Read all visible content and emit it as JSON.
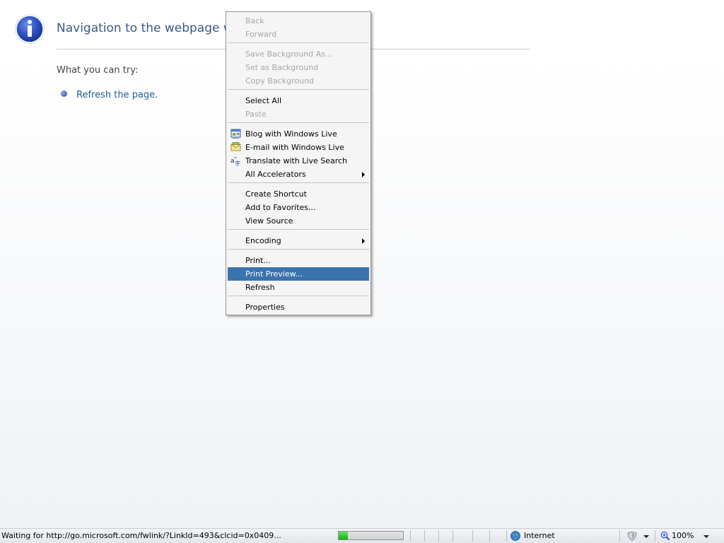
{
  "page": {
    "title": "Navigation to the webpage was",
    "try_heading": "What you can try:",
    "suggestions": [
      {
        "label": "Refresh the page."
      }
    ]
  },
  "context_menu": {
    "highlight_color": "#3a73ad",
    "items": [
      {
        "label": "Back",
        "enabled": false
      },
      {
        "label": "Forward",
        "enabled": false
      },
      {
        "label": "Save Background As...",
        "enabled": false
      },
      {
        "label": "Set as Background",
        "enabled": false
      },
      {
        "label": "Copy Background",
        "enabled": false
      },
      {
        "label": "Select All",
        "enabled": true
      },
      {
        "label": "Paste",
        "enabled": false
      },
      {
        "label": "Blog with Windows Live",
        "enabled": true,
        "icon": "blog-icon"
      },
      {
        "label": "E-mail with Windows Live",
        "enabled": true,
        "icon": "email-icon"
      },
      {
        "label": "Translate with Live Search",
        "enabled": true,
        "icon": "translate-icon"
      },
      {
        "label": "All Accelerators",
        "enabled": true,
        "submenu": true
      },
      {
        "label": "Create Shortcut",
        "enabled": true
      },
      {
        "label": "Add to Favorites...",
        "enabled": true
      },
      {
        "label": "View Source",
        "enabled": true
      },
      {
        "label": "Encoding",
        "enabled": true,
        "submenu": true
      },
      {
        "label": "Print...",
        "enabled": true
      },
      {
        "label": "Print Preview...",
        "enabled": true,
        "highlighted": true
      },
      {
        "label": "Refresh",
        "enabled": true
      },
      {
        "label": "Properties",
        "enabled": true
      }
    ]
  },
  "status_bar": {
    "status_text": "Waiting for http://go.microsoft.com/fwlink/?LinkId=493&clcid=0x0409...",
    "progress_fraction": 0.14,
    "zone_label": "Internet",
    "zone_icon": "globe-icon",
    "protected_mode_icon": "protected-mode-icon",
    "zoom_label": "100%"
  }
}
